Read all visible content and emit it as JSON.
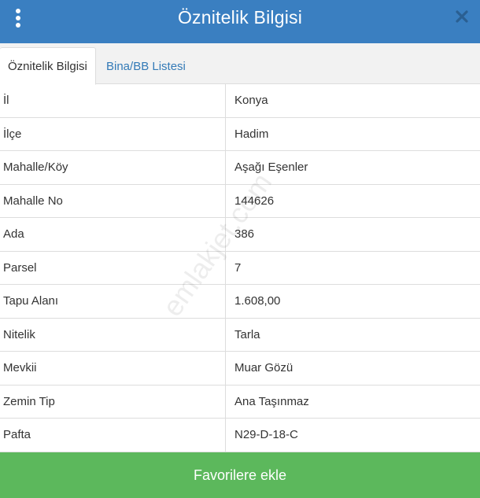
{
  "header": {
    "title": "Öznitelik Bilgisi",
    "menu_icon": "kebab-menu-icon",
    "close_icon": "close-icon",
    "bg_color": "#3a7fc1"
  },
  "tabs": [
    {
      "label": "Öznitelik Bilgisi",
      "active": true
    },
    {
      "label": "Bina/BB Listesi",
      "active": false
    }
  ],
  "rows": [
    {
      "label": "İl",
      "value": "Konya"
    },
    {
      "label": "İlçe",
      "value": "Hadim"
    },
    {
      "label": "Mahalle/Köy",
      "value": "Aşağı Eşenler"
    },
    {
      "label": "Mahalle No",
      "value": "144626"
    },
    {
      "label": "Ada",
      "value": "386"
    },
    {
      "label": "Parsel",
      "value": "7"
    },
    {
      "label": "Tapu Alanı",
      "value": "1.608,00"
    },
    {
      "label": "Nitelik",
      "value": "Tarla"
    },
    {
      "label": "Mevkii",
      "value": "Muar Gözü"
    },
    {
      "label": "Zemin Tip",
      "value": "Ana Taşınmaz"
    },
    {
      "label": "Pafta",
      "value": "N29-D-18-C"
    }
  ],
  "watermark": "emlakjet.com",
  "footer": {
    "button_label": "Favorilere ekle",
    "button_color": "#5cb85c"
  }
}
